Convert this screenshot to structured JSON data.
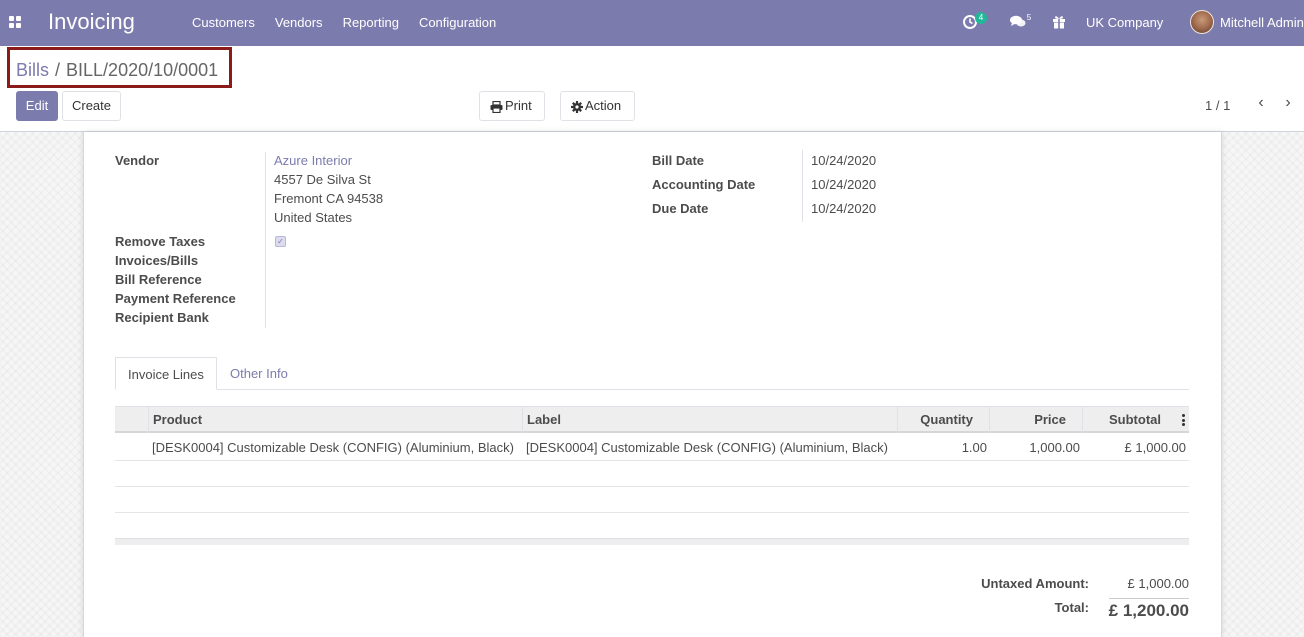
{
  "navbar": {
    "app_name": "Invoicing",
    "menu": [
      "Customers",
      "Vendors",
      "Reporting",
      "Configuration"
    ],
    "activity_count": "4",
    "messages_count": "5",
    "company": "UK Company",
    "user": "Mitchell Admin",
    "color": "#7c7bad"
  },
  "breadcrumb": {
    "parent": "Bills",
    "separator": "/",
    "current": "BILL/2020/10/0001"
  },
  "buttons": {
    "edit": "Edit",
    "create": "Create",
    "print": "Print",
    "action": "Action"
  },
  "pager": {
    "value": "1 / 1"
  },
  "form": {
    "vendor_label": "Vendor",
    "vendor_name": "Azure Interior",
    "vendor_address": [
      "4557 De Silva St",
      "Fremont CA 94538",
      "United States"
    ],
    "remove_taxes_label": "Remove Taxes",
    "remove_taxes_checked": true,
    "invoices_bills_label": "Invoices/Bills",
    "bill_reference_label": "Bill Reference",
    "payment_reference_label": "Payment Reference",
    "recipient_bank_label": "Recipient Bank",
    "bill_date_label": "Bill Date",
    "bill_date": "10/24/2020",
    "accounting_date_label": "Accounting Date",
    "accounting_date": "10/24/2020",
    "due_date_label": "Due Date",
    "due_date": "10/24/2020"
  },
  "tabs": {
    "invoice_lines": "Invoice Lines",
    "other_info": "Other Info"
  },
  "table": {
    "headers": {
      "product": "Product",
      "label": "Label",
      "quantity": "Quantity",
      "price": "Price",
      "subtotal": "Subtotal"
    },
    "rows": [
      {
        "product": "[DESK0004] Customizable Desk (CONFIG) (Aluminium, Black)",
        "label": "[DESK0004] Customizable Desk (CONFIG) (Aluminium, Black)",
        "quantity": "1.00",
        "price": "1,000.00",
        "subtotal": "£ 1,000.00"
      }
    ]
  },
  "totals": {
    "untaxed_label": "Untaxed Amount:",
    "untaxed_value": "£ 1,000.00",
    "total_label": "Total:",
    "total_value": "£ 1,200.00"
  }
}
